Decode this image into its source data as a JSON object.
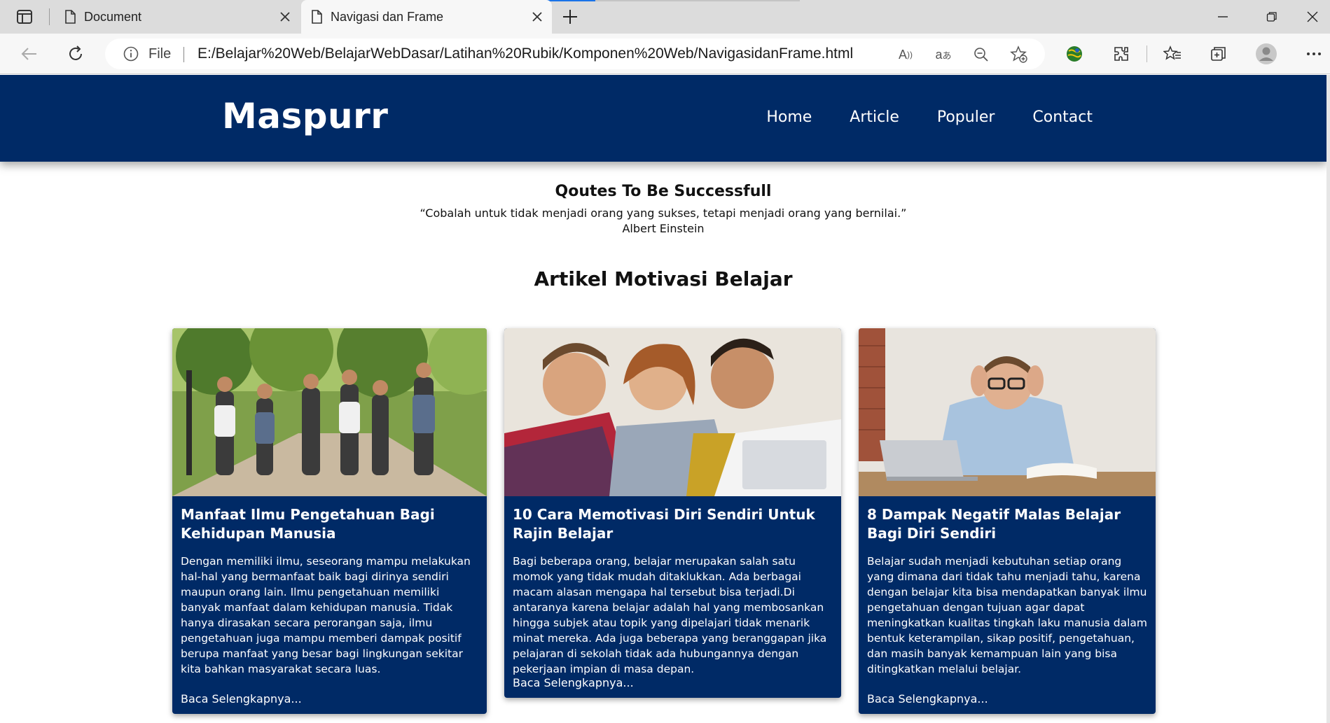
{
  "browser": {
    "tabs": [
      {
        "label": "Document",
        "active": false
      },
      {
        "label": "Navigasi dan Frame",
        "active": true
      }
    ],
    "address": {
      "scheme_label": "File",
      "url": "E:/Belajar%20Web/BelajarWebDasar/Latihan%20Rubik/Komponen%20Web/NavigasidanFrame.html"
    }
  },
  "site": {
    "logo": "Maspurr",
    "menu": [
      "Home",
      "Article",
      "Populer",
      "Contact"
    ]
  },
  "quote": {
    "title": "Qoutes To Be Successfull",
    "text": "“Cobalah untuk tidak menjadi orang yang sukses, tetapi menjadi orang yang bernilai.”",
    "author": "Albert Einstein"
  },
  "section_title": "Artikel Motivasi Belajar",
  "articles": [
    {
      "title": "Manfaat Ilmu Pengetahuan Bagi Kehidupan Manusia",
      "text": "Dengan memiliki ilmu, seseorang mampu melakukan hal-hal yang bermanfaat baik bagi dirinya sendiri maupun orang lain. Ilmu pengetahuan memiliki banyak manfaat dalam kehidupan manusia. Tidak hanya dirasakan secara perorangan saja, ilmu pengetahuan juga mampu memberi dampak positif berupa manfaat yang besar bagi lingkungan sekitar kita bahkan masyarakat secara luas.",
      "link": "Baca Selengkapnya...",
      "image": "students-walking-photo"
    },
    {
      "title": "10 Cara Memotivasi Diri Sendiri Untuk Rajin Belajar",
      "text": "Bagi beberapa orang, belajar merupakan salah satu momok yang tidak mudah ditaklukkan. Ada berbagai macam alasan mengapa hal tersebut bisa terjadi.Di antaranya karena belajar adalah hal yang membosankan hingga subjek atau topik yang dipelajari tidak menarik minat mereka. Ada juga beberapa yang beranggapan jika pelajaran di sekolah tidak ada hubungannya dengan pekerjaan impian di masa depan.",
      "link": "Baca Selengkapnya...",
      "image": "friends-laptop-photo"
    },
    {
      "title": "8 Dampak Negatif Malas Belajar Bagi Diri Sendiri",
      "text": "Belajar sudah menjadi kebutuhan setiap orang yang dimana dari tidak tahu menjadi tahu, karena dengan belajar kita bisa mendapatkan banyak ilmu pengetahuan dengan tujuan agar dapat meningkatkan kualitas tingkah laku manusia dalam bentuk keterampilan, sikap positif, pengetahuan, dan masih banyak kemampuan lain yang bisa ditingkatkan melalui belajar.",
      "link": "Baca Selengkapnya...",
      "image": "stressed-man-photo"
    }
  ],
  "colors": {
    "header_bg": "#002a66",
    "card_bg": "#002a66",
    "accent_blue": "#1a73e8"
  }
}
